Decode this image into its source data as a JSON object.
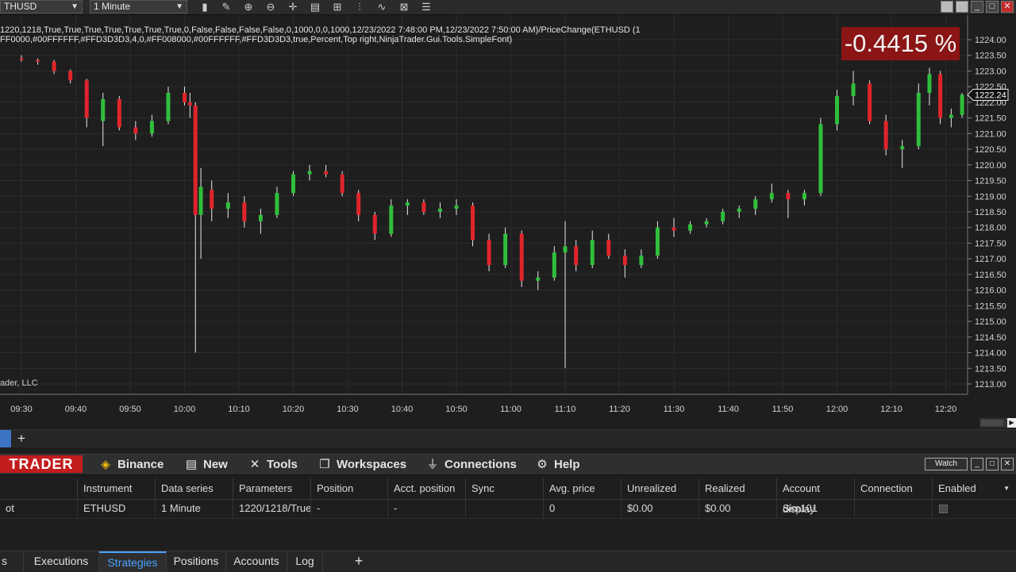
{
  "toolbar": {
    "instrument": "THUSD",
    "interval": "1 Minute",
    "icons": [
      "bar-chart-icon",
      "pencil-icon",
      "zoom-in-icon",
      "zoom-out-icon",
      "crosshair-icon",
      "data-box-icon",
      "chart-trader-icon",
      "indicators-icon",
      "strategies-icon",
      "properties-icon",
      "list-icon"
    ]
  },
  "chart": {
    "indicator_line1": "1220,1218,True,True,True,True,True,True,True,0,False,False,False,False,0,1000,0,0,1000,12/23/2022 7:48:00 PM,12/23/2022 7:50:00 AM)/PriceChange(ETHUSD (1",
    "indicator_line2": "FF0000,#00FFFFFF,#FFD3D3D3,4,0,#FF008000,#00FFFFFF,#FFD3D3D3,true,Percent,Top right,NinjaTrader.Gui.Tools.SimpleFont)",
    "price_change": "-0.4415 %",
    "copyright": "ader, LLC",
    "last_price": "1222.24",
    "colors": {
      "up": "#2fbf3b",
      "down": "#e0242b",
      "wick": "#e8e8e8",
      "background": "#1e1e1e",
      "badge": "#8b1414"
    }
  },
  "chart_data": {
    "type": "candlestick",
    "x_ticks": [
      "09:30",
      "09:40",
      "09:50",
      "10:00",
      "10:10",
      "10:20",
      "10:30",
      "10:40",
      "10:50",
      "11:00",
      "11:10",
      "11:20",
      "11:30",
      "11:40",
      "11:50",
      "12:00",
      "12:10",
      "12:20"
    ],
    "y_ticks": [
      "1224.00",
      "1223.50",
      "1223.00",
      "1222.50",
      "1222.00",
      "1221.50",
      "1221.00",
      "1220.50",
      "1220.00",
      "1219.50",
      "1219.00",
      "1218.50",
      "1218.00",
      "1217.50",
      "1217.00",
      "1216.50",
      "1216.00",
      "1215.50",
      "1215.00",
      "1214.50",
      "1214.00",
      "1213.50",
      "1213.00"
    ],
    "ylim": [
      1213.0,
      1224.0
    ],
    "grid": true,
    "candles": [
      {
        "t": "09:30",
        "o": 1223.4,
        "h": 1223.5,
        "l": 1223.3,
        "c": 1223.35
      },
      {
        "t": "09:33",
        "o": 1223.35,
        "h": 1223.4,
        "l": 1223.2,
        "c": 1223.3
      },
      {
        "t": "09:36",
        "o": 1223.3,
        "h": 1223.35,
        "l": 1222.9,
        "c": 1223.0
      },
      {
        "t": "09:39",
        "o": 1223.0,
        "h": 1223.05,
        "l": 1222.6,
        "c": 1222.7
      },
      {
        "t": "09:42",
        "o": 1222.7,
        "h": 1222.75,
        "l": 1221.2,
        "c": 1221.5
      },
      {
        "t": "09:45",
        "o": 1221.4,
        "h": 1222.3,
        "l": 1220.6,
        "c": 1222.1
      },
      {
        "t": "09:48",
        "o": 1222.1,
        "h": 1222.2,
        "l": 1221.1,
        "c": 1221.2
      },
      {
        "t": "09:51",
        "o": 1221.2,
        "h": 1221.4,
        "l": 1220.8,
        "c": 1221.0
      },
      {
        "t": "09:54",
        "o": 1221.0,
        "h": 1221.6,
        "l": 1220.9,
        "c": 1221.4
      },
      {
        "t": "09:57",
        "o": 1221.4,
        "h": 1222.5,
        "l": 1221.3,
        "c": 1222.3
      },
      {
        "t": "10:00",
        "o": 1222.3,
        "h": 1222.5,
        "l": 1221.9,
        "c": 1222.0
      },
      {
        "t": "10:01",
        "o": 1222.0,
        "h": 1222.3,
        "l": 1221.5,
        "c": 1221.9
      },
      {
        "t": "10:02",
        "o": 1221.9,
        "h": 1222.0,
        "l": 1214.0,
        "c": 1218.4
      },
      {
        "t": "10:03",
        "o": 1218.4,
        "h": 1219.9,
        "l": 1217.0,
        "c": 1219.3
      },
      {
        "t": "10:05",
        "o": 1219.2,
        "h": 1219.5,
        "l": 1218.2,
        "c": 1218.6
      },
      {
        "t": "10:08",
        "o": 1218.6,
        "h": 1219.1,
        "l": 1218.3,
        "c": 1218.8
      },
      {
        "t": "10:11",
        "o": 1218.8,
        "h": 1219.0,
        "l": 1218.0,
        "c": 1218.2
      },
      {
        "t": "10:14",
        "o": 1218.2,
        "h": 1218.6,
        "l": 1217.8,
        "c": 1218.4
      },
      {
        "t": "10:17",
        "o": 1218.4,
        "h": 1219.3,
        "l": 1218.3,
        "c": 1219.1
      },
      {
        "t": "10:20",
        "o": 1219.1,
        "h": 1219.8,
        "l": 1219.0,
        "c": 1219.7
      },
      {
        "t": "10:23",
        "o": 1219.7,
        "h": 1220.0,
        "l": 1219.5,
        "c": 1219.8
      },
      {
        "t": "10:26",
        "o": 1219.8,
        "h": 1220.0,
        "l": 1219.6,
        "c": 1219.7
      },
      {
        "t": "10:29",
        "o": 1219.7,
        "h": 1219.8,
        "l": 1219.0,
        "c": 1219.1
      },
      {
        "t": "10:32",
        "o": 1219.1,
        "h": 1219.2,
        "l": 1218.2,
        "c": 1218.4
      },
      {
        "t": "10:35",
        "o": 1218.4,
        "h": 1218.5,
        "l": 1217.6,
        "c": 1217.8
      },
      {
        "t": "10:38",
        "o": 1217.8,
        "h": 1218.9,
        "l": 1217.7,
        "c": 1218.7
      },
      {
        "t": "10:41",
        "o": 1218.7,
        "h": 1218.9,
        "l": 1218.4,
        "c": 1218.8
      },
      {
        "t": "10:44",
        "o": 1218.8,
        "h": 1218.9,
        "l": 1218.4,
        "c": 1218.5
      },
      {
        "t": "10:47",
        "o": 1218.5,
        "h": 1218.8,
        "l": 1218.3,
        "c": 1218.6
      },
      {
        "t": "10:50",
        "o": 1218.6,
        "h": 1218.9,
        "l": 1218.4,
        "c": 1218.7
      },
      {
        "t": "10:53",
        "o": 1218.7,
        "h": 1218.8,
        "l": 1217.4,
        "c": 1217.6
      },
      {
        "t": "10:56",
        "o": 1217.6,
        "h": 1217.8,
        "l": 1216.6,
        "c": 1216.8
      },
      {
        "t": "10:59",
        "o": 1216.8,
        "h": 1218.0,
        "l": 1216.7,
        "c": 1217.8
      },
      {
        "t": "11:02",
        "o": 1217.8,
        "h": 1217.9,
        "l": 1216.1,
        "c": 1216.3
      },
      {
        "t": "11:05",
        "o": 1216.3,
        "h": 1216.6,
        "l": 1216.0,
        "c": 1216.4
      },
      {
        "t": "11:08",
        "o": 1216.4,
        "h": 1217.4,
        "l": 1216.3,
        "c": 1217.2
      },
      {
        "t": "11:10",
        "o": 1217.2,
        "h": 1218.2,
        "l": 1213.5,
        "c": 1217.4
      },
      {
        "t": "11:12",
        "o": 1217.4,
        "h": 1217.6,
        "l": 1216.6,
        "c": 1216.8
      },
      {
        "t": "11:15",
        "o": 1216.8,
        "h": 1217.9,
        "l": 1216.7,
        "c": 1217.6
      },
      {
        "t": "11:18",
        "o": 1217.6,
        "h": 1217.8,
        "l": 1217.0,
        "c": 1217.1
      },
      {
        "t": "11:21",
        "o": 1217.1,
        "h": 1217.3,
        "l": 1216.4,
        "c": 1216.8
      },
      {
        "t": "11:24",
        "o": 1216.8,
        "h": 1217.3,
        "l": 1216.7,
        "c": 1217.1
      },
      {
        "t": "11:27",
        "o": 1217.1,
        "h": 1218.2,
        "l": 1217.0,
        "c": 1218.0
      },
      {
        "t": "11:30",
        "o": 1218.0,
        "h": 1218.3,
        "l": 1217.7,
        "c": 1217.9
      },
      {
        "t": "11:33",
        "o": 1217.9,
        "h": 1218.2,
        "l": 1217.8,
        "c": 1218.1
      },
      {
        "t": "11:36",
        "o": 1218.1,
        "h": 1218.3,
        "l": 1218.0,
        "c": 1218.2
      },
      {
        "t": "11:39",
        "o": 1218.2,
        "h": 1218.6,
        "l": 1218.1,
        "c": 1218.5
      },
      {
        "t": "11:42",
        "o": 1218.5,
        "h": 1218.7,
        "l": 1218.3,
        "c": 1218.6
      },
      {
        "t": "11:45",
        "o": 1218.6,
        "h": 1219.0,
        "l": 1218.4,
        "c": 1218.9
      },
      {
        "t": "11:48",
        "o": 1218.9,
        "h": 1219.4,
        "l": 1218.8,
        "c": 1219.1
      },
      {
        "t": "11:51",
        "o": 1219.1,
        "h": 1219.2,
        "l": 1218.3,
        "c": 1218.9
      },
      {
        "t": "11:54",
        "o": 1218.9,
        "h": 1219.2,
        "l": 1218.7,
        "c": 1219.1
      },
      {
        "t": "11:57",
        "o": 1219.1,
        "h": 1221.5,
        "l": 1219.0,
        "c": 1221.3
      },
      {
        "t": "12:00",
        "o": 1221.3,
        "h": 1222.4,
        "l": 1221.1,
        "c": 1222.2
      },
      {
        "t": "12:03",
        "o": 1222.2,
        "h": 1223.0,
        "l": 1221.9,
        "c": 1222.6
      },
      {
        "t": "12:06",
        "o": 1222.6,
        "h": 1222.7,
        "l": 1221.3,
        "c": 1221.4
      },
      {
        "t": "12:09",
        "o": 1221.4,
        "h": 1221.6,
        "l": 1220.3,
        "c": 1220.5
      },
      {
        "t": "12:12",
        "o": 1220.5,
        "h": 1220.8,
        "l": 1219.9,
        "c": 1220.6
      },
      {
        "t": "12:15",
        "o": 1220.6,
        "h": 1222.6,
        "l": 1220.5,
        "c": 1222.3
      },
      {
        "t": "12:17",
        "o": 1222.3,
        "h": 1223.1,
        "l": 1221.9,
        "c": 1222.9
      },
      {
        "t": "12:19",
        "o": 1222.9,
        "h": 1223.0,
        "l": 1221.3,
        "c": 1221.5
      },
      {
        "t": "12:21",
        "o": 1221.5,
        "h": 1221.8,
        "l": 1221.2,
        "c": 1221.6
      },
      {
        "t": "12:23",
        "o": 1221.6,
        "h": 1222.3,
        "l": 1221.5,
        "c": 1222.24
      }
    ]
  },
  "tabs": {
    "plus": "+"
  },
  "menubar": {
    "logo": "TRADER",
    "items": [
      {
        "icon": "binance-icon",
        "glyph": "◈",
        "label": "Binance"
      },
      {
        "icon": "new-icon",
        "glyph": "▤",
        "label": "New"
      },
      {
        "icon": "tools-icon",
        "glyph": "✕",
        "label": "Tools"
      },
      {
        "icon": "workspaces-icon",
        "glyph": "❐",
        "label": "Workspaces"
      },
      {
        "icon": "connections-icon",
        "glyph": "⏚",
        "label": "Connections"
      },
      {
        "icon": "help-icon",
        "glyph": "⚙",
        "label": "Help"
      }
    ],
    "watch": "Watch"
  },
  "grid": {
    "headers": [
      "",
      "Instrument",
      "Data series",
      "Parameters",
      "Position",
      "Acct. position",
      "Sync",
      "Avg. price",
      "Unrealized",
      "Realized",
      "Account display",
      "Connection",
      "Enabled"
    ],
    "rows": [
      [
        "ot",
        "ETHUSD",
        "1 Minute",
        "1220/1218/True",
        "-",
        "-",
        "",
        "0",
        "$0.00",
        "$0.00",
        "Sim101",
        "",
        ""
      ]
    ]
  },
  "bottom_tabs": [
    "s",
    "Executions",
    "Strategies",
    "Positions",
    "Accounts",
    "Log",
    "+"
  ],
  "active_bottom_tab": "Strategies"
}
